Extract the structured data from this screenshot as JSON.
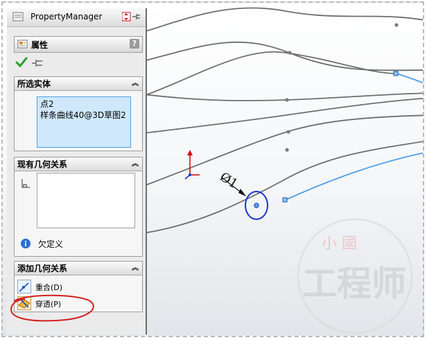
{
  "panel": {
    "title": "PropertyManager",
    "properties_label": "属性",
    "help_label": "?",
    "selected_entities": {
      "header": "所选实体",
      "items": [
        "点2",
        "样条曲线40@3D草图2"
      ]
    },
    "existing_relations": {
      "header": "现有几何关系",
      "status_text": "欠定义"
    },
    "add_relations": {
      "header": "添加几何关系",
      "items": [
        {
          "label": "重合(D)",
          "icon": "coincident-icon"
        },
        {
          "label": "穿透(P)",
          "icon": "pierce-icon"
        }
      ]
    }
  },
  "canvas": {
    "dimension_label": "Ø1",
    "watermark_main": "工程师",
    "watermark_top": "小  國",
    "colors": {
      "curve": "#6e6e6e",
      "selected_curve": "#4b9ee6",
      "dimension_circle": "#1a36c8",
      "annotation_red": "#d42020"
    }
  }
}
